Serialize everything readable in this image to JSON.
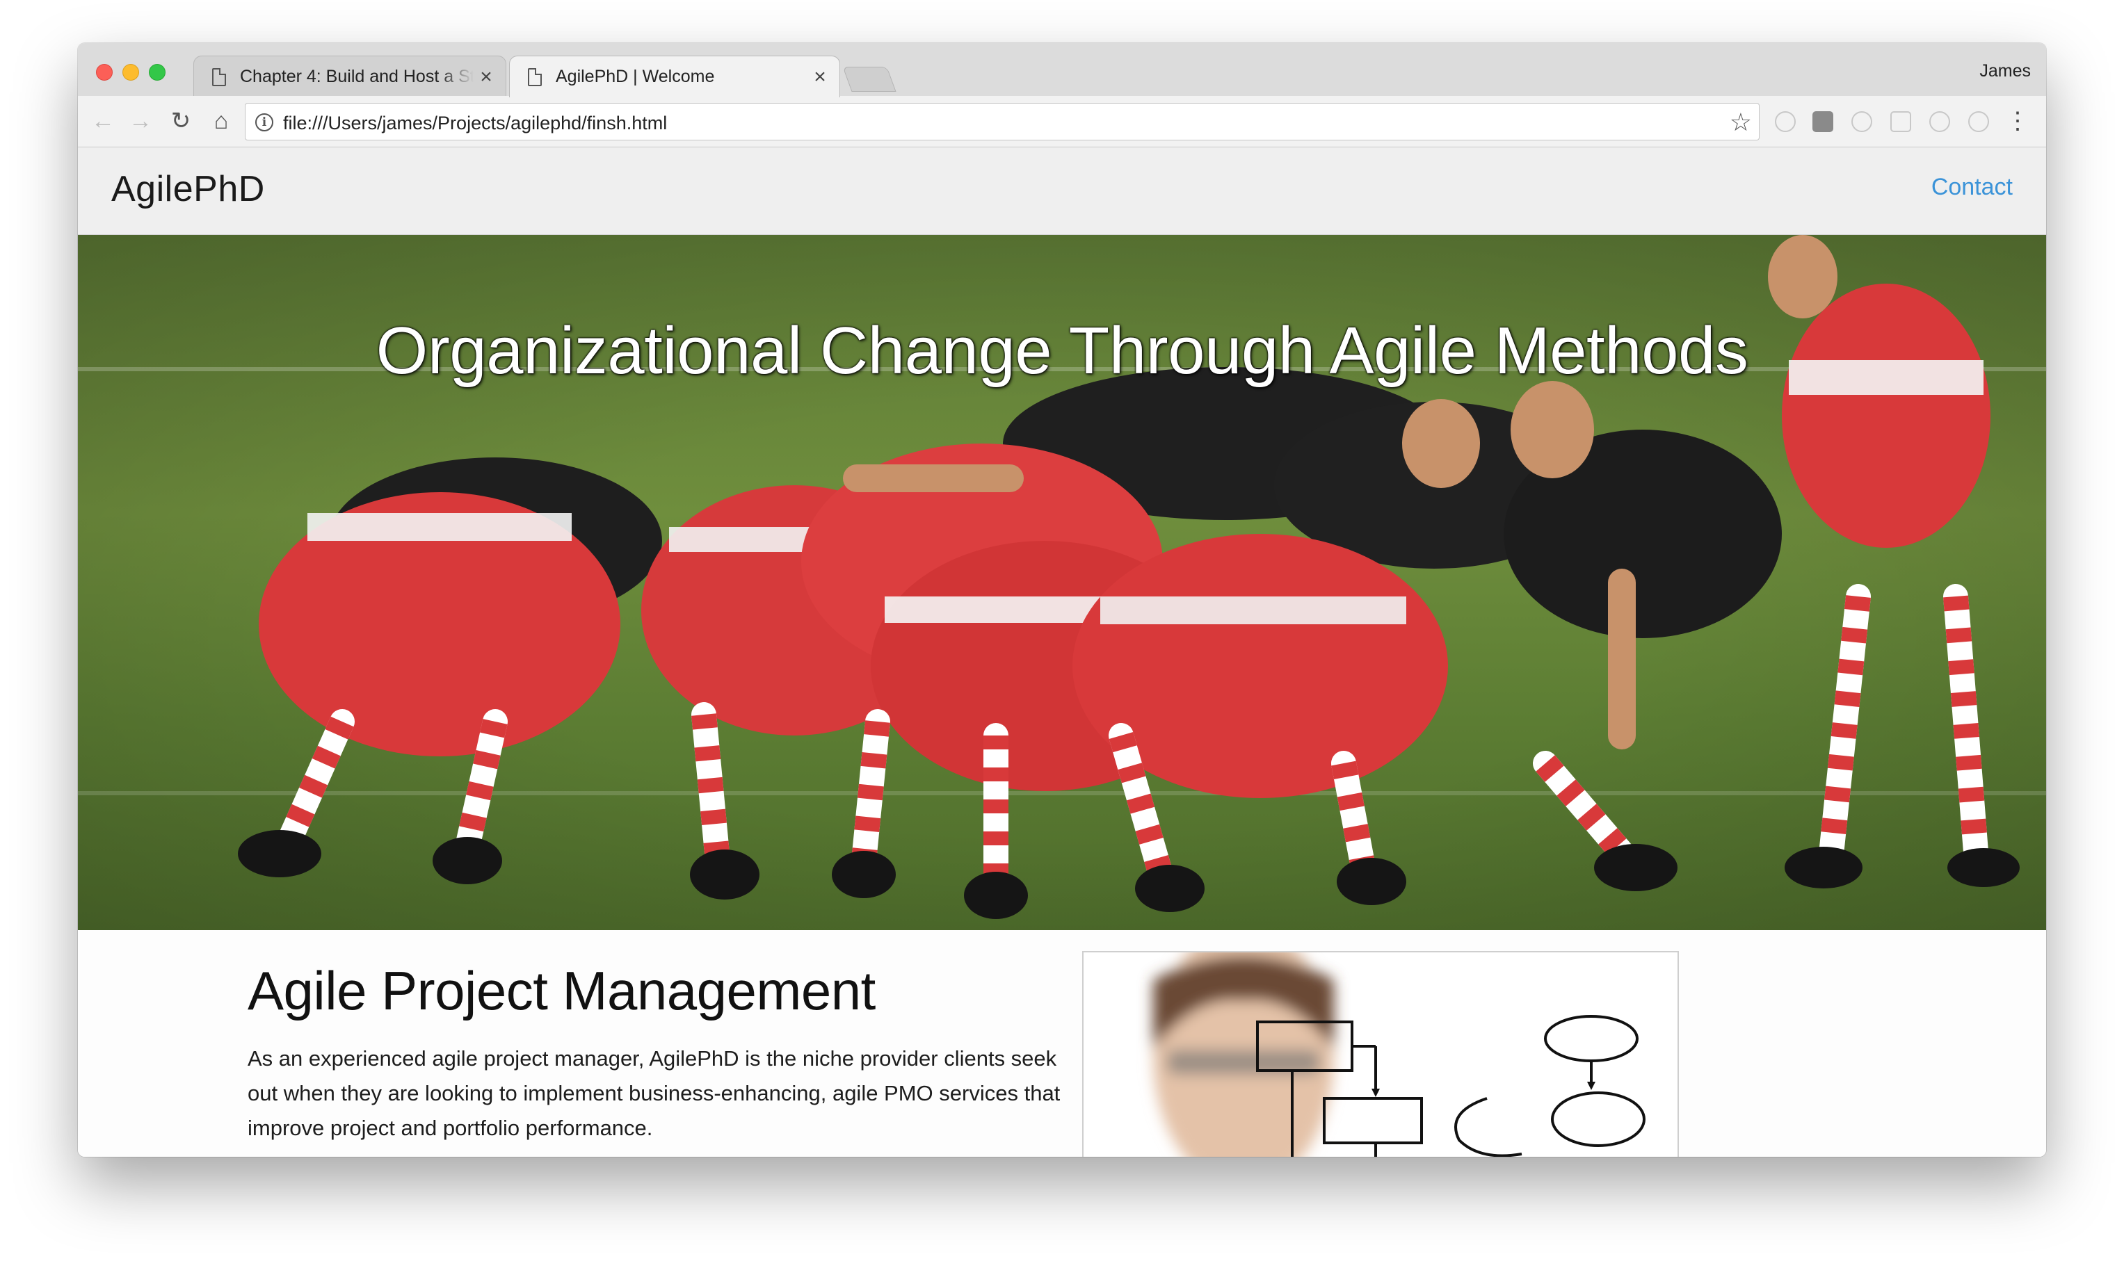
{
  "browser": {
    "tabs": [
      {
        "title": "Chapter 4: Build and Host a St",
        "close": "×"
      },
      {
        "title": "AgilePhD | Welcome",
        "close": "×"
      }
    ],
    "profile_name": "James",
    "url": "file:///Users/james/Projects/agilephd/finsh.html",
    "icons": {
      "back": "←",
      "forward": "→",
      "reload": "↻",
      "home": "⌂",
      "info": "i",
      "star": "☆",
      "menu": "⋮"
    }
  },
  "site": {
    "brand": "AgilePhD",
    "nav": {
      "contact": "Contact"
    },
    "hero": {
      "title": "Organizational Change Through Agile Methods"
    },
    "section": {
      "heading": "Agile Project Management",
      "body": "As an experienced agile project manager, AgilePhD is the niche provider clients seek out when they are looking to implement business-enhancing, agile PMO services that improve project and portfolio performance."
    }
  },
  "colors": {
    "accent_link": "#3b93d8",
    "jersey_red": "#d8393a",
    "jersey_black": "#1f1f1f",
    "grass": "#5d7a35"
  }
}
